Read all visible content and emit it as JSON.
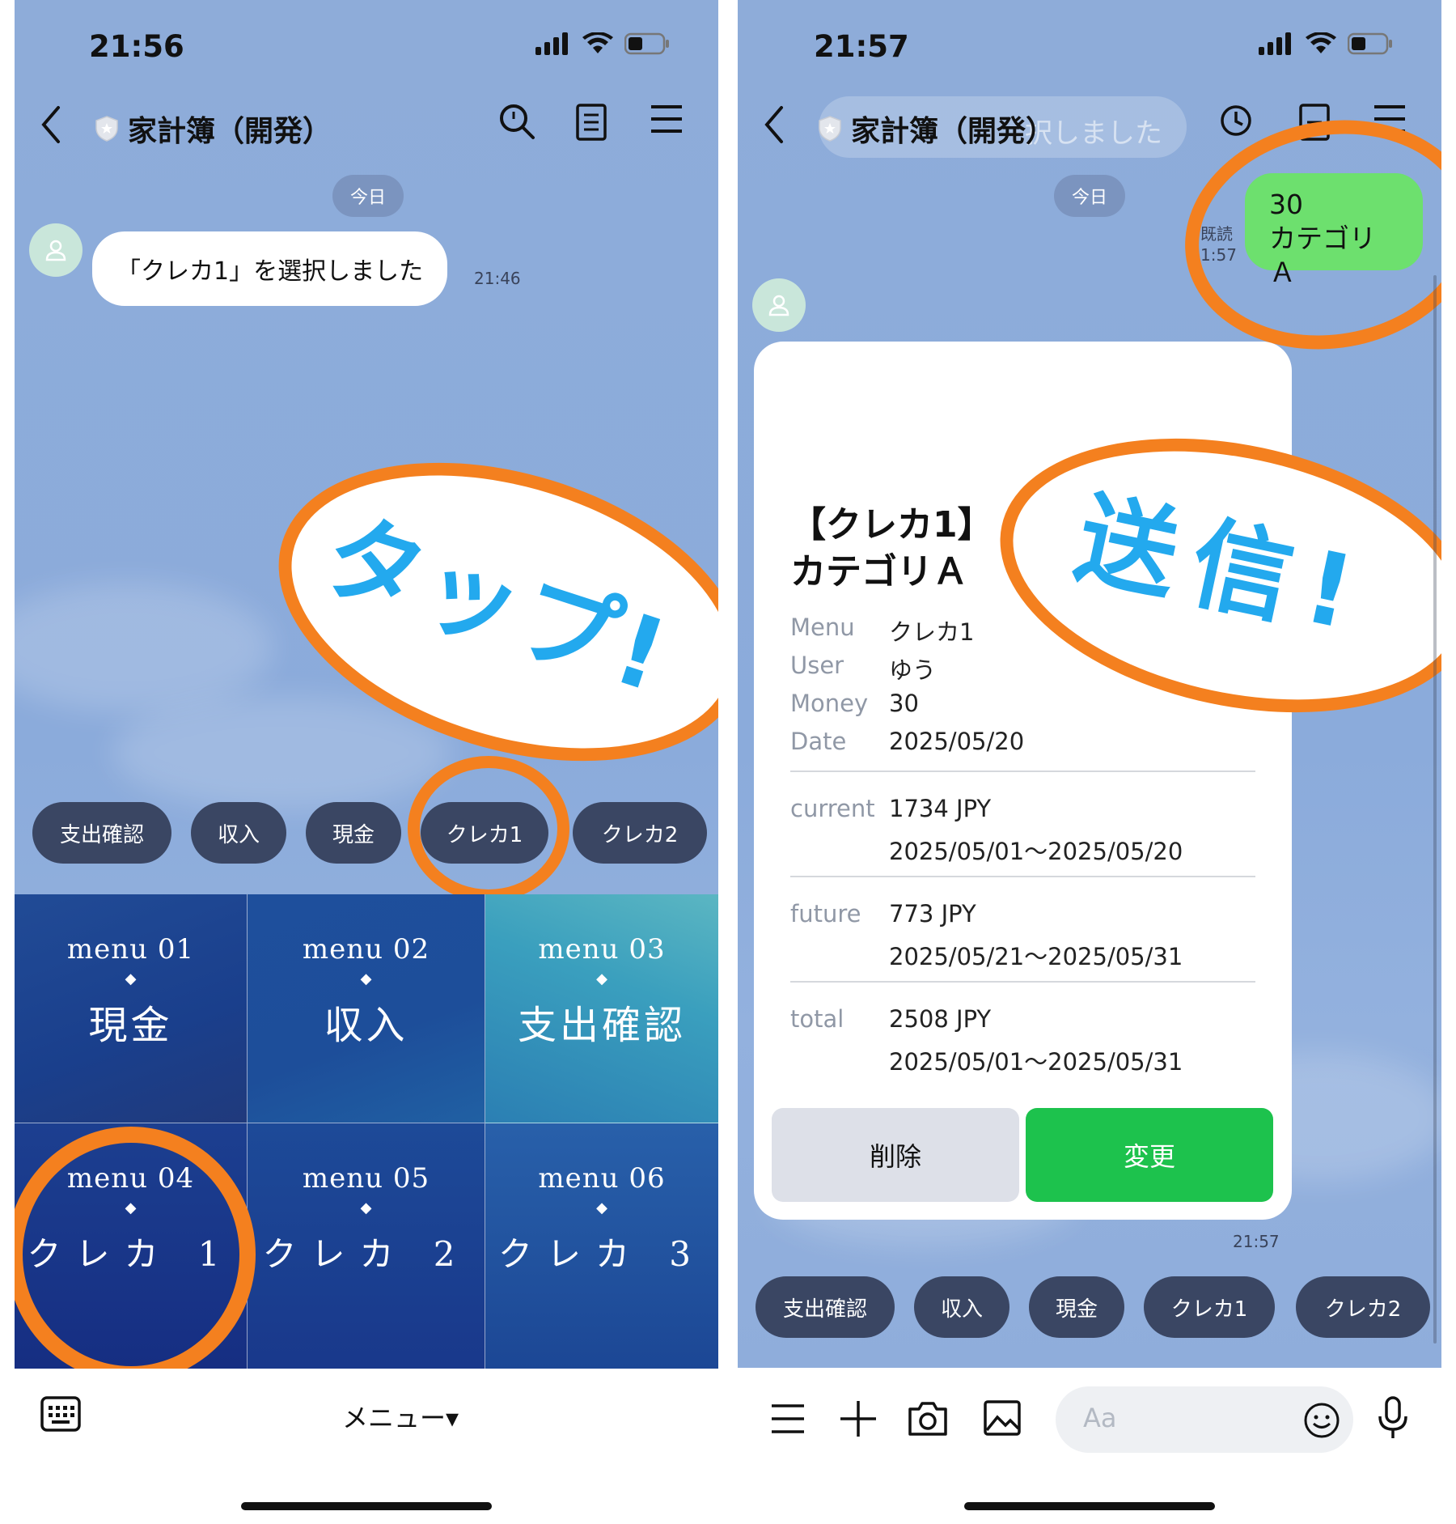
{
  "left": {
    "status_time": "21:56",
    "title": "家計簿（開発）",
    "date_label": "今日",
    "message": "「クレカ1」を選択しました",
    "message_time": "21:46",
    "chips": [
      "支出確認",
      "収入",
      "現金",
      "クレカ1",
      "クレカ2"
    ],
    "rich_menu": [
      {
        "num": "menu 01",
        "label": "現金"
      },
      {
        "num": "menu 02",
        "label": "収入"
      },
      {
        "num": "menu 03",
        "label": "支出確認"
      },
      {
        "num": "menu 04",
        "label": "クレカ 1"
      },
      {
        "num": "menu 05",
        "label": "クレカ 2"
      },
      {
        "num": "menu 06",
        "label": "クレカ 3"
      }
    ],
    "diamond": "◆",
    "menu_toggle": "メニュー▾",
    "annotation": "タップ!"
  },
  "right": {
    "status_time": "21:57",
    "title": "家計簿（開発）",
    "ghost_text": "択しました",
    "date_label": "今日",
    "read_label": "既読",
    "read_time": "1:57",
    "sent_amount": "30",
    "sent_category": "カテゴリＡ",
    "card": {
      "title_line1": "【クレカ1】",
      "title_line2": "カテゴリＡ",
      "rows": [
        {
          "key": "Menu",
          "value": "クレカ1"
        },
        {
          "key": "User",
          "value": "ゆう"
        },
        {
          "key": "Money",
          "value": "30"
        },
        {
          "key": "Date",
          "value": "2025/05/20"
        }
      ],
      "current_key": "current",
      "current_amount": "1734 JPY",
      "current_range": "2025/05/01～2025/05/20",
      "future_key": "future",
      "future_amount": "773 JPY",
      "future_range": "2025/05/21～2025/05/31",
      "total_key": "total",
      "total_amount": "2508 JPY",
      "total_range": "2025/05/01～2025/05/31",
      "delete_label": "削除",
      "change_label": "変更"
    },
    "card_time": "21:57",
    "chips": [
      "支出確認",
      "収入",
      "現金",
      "クレカ1",
      "クレカ2"
    ],
    "input_placeholder": "Aa",
    "annotation": "送信!"
  },
  "colors": {
    "chat_bg": "#8eacd9",
    "chip_bg": "#3a4663",
    "annotation_orange": "#f4801f",
    "annotation_blue": "#23a9ee",
    "sent_bubble": "#6de06e",
    "change_button": "#1dc24d",
    "delete_button": "#dde0e8"
  }
}
